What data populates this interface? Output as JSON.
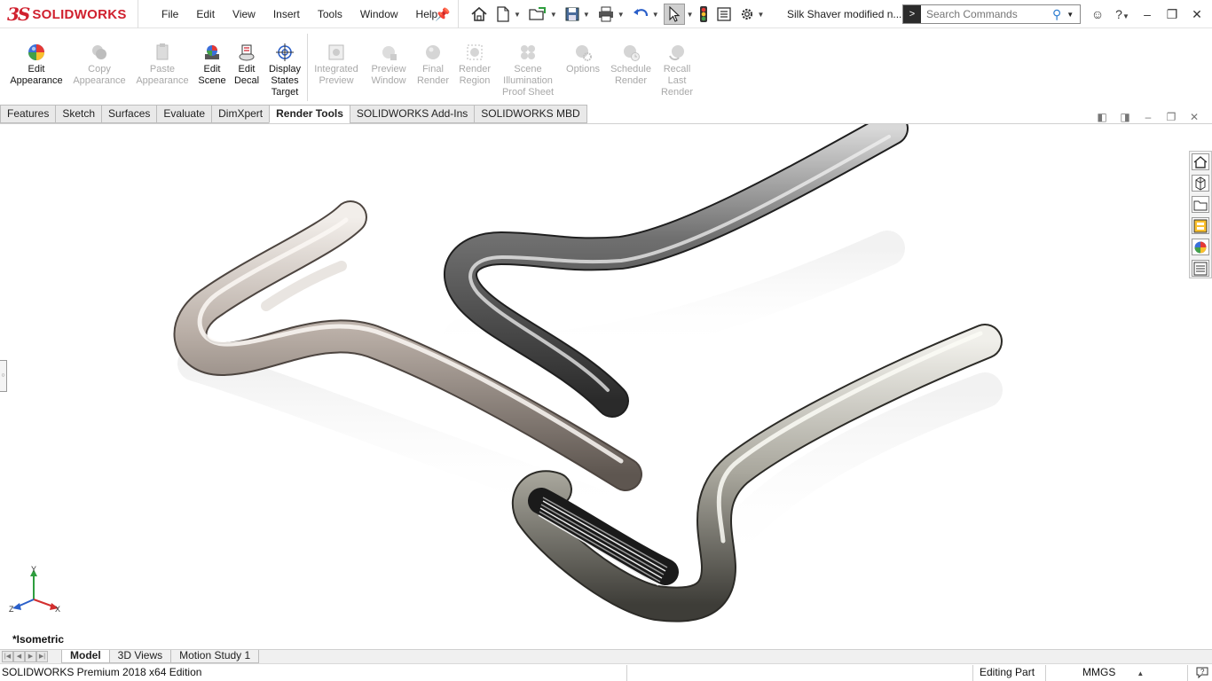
{
  "app": {
    "logo_text": "SOLIDWORKS",
    "document_title": "Silk Shaver modified n..."
  },
  "menu": [
    "File",
    "Edit",
    "View",
    "Insert",
    "Tools",
    "Window",
    "Help"
  ],
  "search": {
    "placeholder": "Search Commands"
  },
  "commands": {
    "edit_appearance": "Edit Appearance",
    "copy_appearance": "Copy Appearance",
    "paste_appearance": "Paste Appearance",
    "edit_scene": "Edit Scene",
    "edit_decal": "Edit Decal",
    "display_states_target": "Display States Target",
    "integrated_preview": "Integrated Preview",
    "preview_window": "Preview Window",
    "final_render": "Final Render",
    "render_region": "Render Region",
    "scene_illumination": "Scene Illumination Proof Sheet",
    "options": "Options",
    "schedule_render": "Schedule Render",
    "recall_last_render": "Recall Last Render"
  },
  "tabs": [
    "Features",
    "Sketch",
    "Surfaces",
    "Evaluate",
    "DimXpert",
    "Render Tools",
    "SOLIDWORKS Add-Ins",
    "SOLIDWORKS MBD"
  ],
  "active_tab": "Render Tools",
  "viewport": {
    "view_name": "*Isometric",
    "triad": {
      "x": "X",
      "y": "Y",
      "z": "Z"
    }
  },
  "bottom_tabs": [
    "Model",
    "3D Views",
    "Motion Study 1"
  ],
  "active_bottom_tab": "Model",
  "status": {
    "edition": "SOLIDWORKS Premium 2018 x64 Edition",
    "mode": "Editing Part",
    "units": "MMGS"
  },
  "colors": {
    "brand_red": "#d0202e",
    "accent_blue": "#2f7fd1",
    "axis_x": "#d32f2f",
    "axis_y": "#2e9e3e",
    "axis_z": "#2a5fc9"
  },
  "icons": {
    "titlebar": [
      "home-icon",
      "new-document-icon",
      "open-icon",
      "save-icon",
      "print-icon",
      "undo-icon",
      "select-icon",
      "rebuild-icon",
      "file-properties-icon",
      "options-gear-icon"
    ],
    "taskpane": [
      "home-icon",
      "parts-library-icon",
      "file-explorer-icon",
      "view-palette-icon",
      "appearances-icon",
      "custom-properties-icon"
    ]
  }
}
